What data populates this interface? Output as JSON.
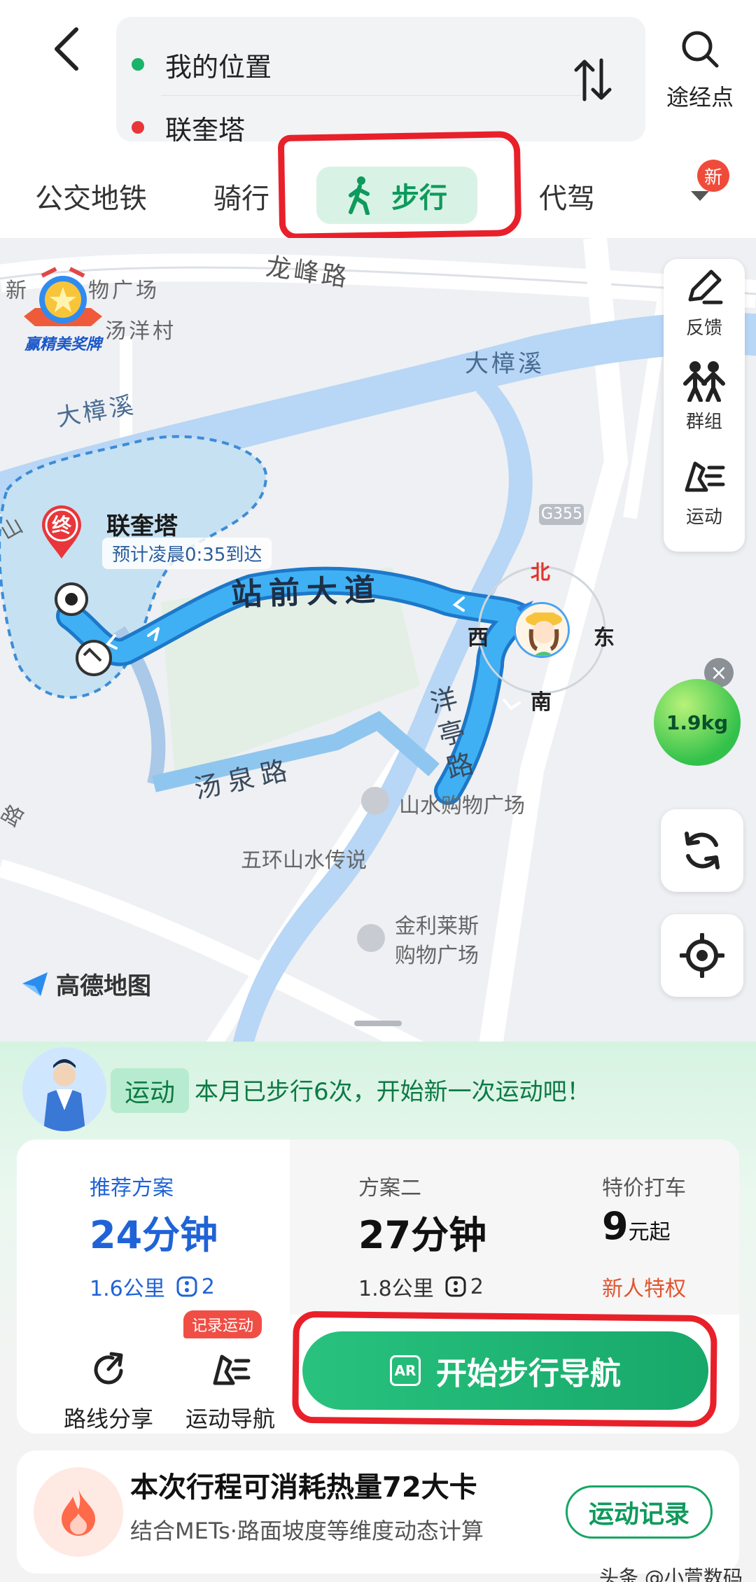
{
  "route": {
    "from": "我的位置",
    "to": "联奎塔",
    "waypoint_label": "途经点"
  },
  "tabs": [
    {
      "label": "公交地铁"
    },
    {
      "label": "骑行"
    },
    {
      "label": "步行",
      "selected": true
    },
    {
      "label": "代驾"
    }
  ],
  "more_badge": "新",
  "map": {
    "labels": {
      "longfeng_road": "龙峰路",
      "datang_river_1": "大樟溪",
      "datang_river_2": "大樟溪",
      "plaza_1": "物广场",
      "tangyang": "汤洋村",
      "new_prefix": "新",
      "zhanqian": "站前大道",
      "yangting": "洋亭路",
      "tangquan": "汤泉路",
      "shanshui_mall": "山水购物广场",
      "wuhuan": "五环山水传说",
      "jinli_1": "金利莱斯",
      "jinli_2": "购物广场",
      "g355": "G355",
      "shan": "山",
      "lu": "路"
    },
    "award_badge": "赢精美奖牌",
    "destination": {
      "marker": "终",
      "name": "联奎塔",
      "eta": "预计凌晨0:35到达"
    },
    "compass": {
      "n": "北",
      "w": "西",
      "e": "东",
      "s": "南"
    },
    "side_tools": [
      {
        "label": "反馈",
        "icon": "pencil-icon"
      },
      {
        "label": "群组",
        "icon": "group-icon"
      },
      {
        "label": "运动",
        "icon": "run-icon"
      }
    ],
    "eco_value": "1.9kg",
    "logo": "高德地图"
  },
  "sport_bar": {
    "tag": "运动",
    "text": "本月已步行6次，开始新一次运动吧！"
  },
  "plans": [
    {
      "title": "推荐方案",
      "time": "24分钟",
      "distance": "1.6公里",
      "lights": "2"
    },
    {
      "title": "方案二",
      "time": "27分钟",
      "distance": "1.8公里",
      "lights": "2"
    },
    {
      "title": "特价打车",
      "price": "9",
      "price_unit": "元起",
      "promo": "新人特权"
    }
  ],
  "actions": {
    "share": "路线分享",
    "sport_nav": "运动导航",
    "record_tag": "记录运动",
    "start": "开始步行导航",
    "ar_icon": "AR"
  },
  "calorie": {
    "title": "本次行程可消耗热量72大卡",
    "subtitle": "结合METs·路面坡度等维度动态计算",
    "button": "运动记录"
  },
  "watermark": "头条 @小萱数码",
  "colors": {
    "brand_green": "#18a566",
    "route_blue": "#2fa4ee",
    "accent_blue": "#1f63d6",
    "annotation_red": "#e8202a"
  }
}
